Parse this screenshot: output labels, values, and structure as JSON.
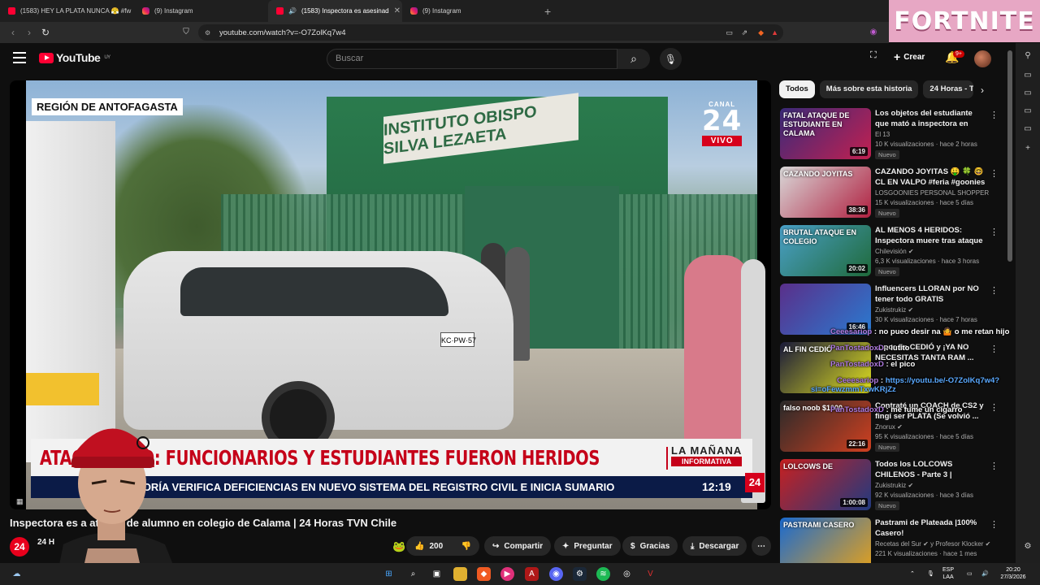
{
  "browser": {
    "tabs": [
      {
        "title": "(1583) HEY LA PLATA NUNCA 😤 #fw",
        "favicon": "youtube-favicon",
        "active": false
      },
      {
        "title": "(9) Instagram",
        "favicon": "instagram-favicon",
        "active": false
      },
      {
        "title": "(1583) Inspectora es asesinad",
        "favicon": "youtube-favicon",
        "active": true
      },
      {
        "title": "(9) Instagram",
        "favicon": "instagram-favicon",
        "active": false
      }
    ],
    "url": "youtube.com/watch?v=-O7ZolKq7w4",
    "new_tab": "+"
  },
  "overlay_banner": "FORTNITE",
  "youtube": {
    "logo_text": "YouTube",
    "region": "UY",
    "search_placeholder": "Buscar",
    "create_label": "Crear",
    "notif_badge": "9+"
  },
  "video": {
    "region_label": "REGIÓN DE ANTOFAGASTA",
    "channel_bug": {
      "canal": "CANAL",
      "number": "24",
      "live": "VIVO"
    },
    "sign_text": "INSTITUTO OBISPO SILVA LEZAETA",
    "plate": "KC·PW·57",
    "headline": "ATAQUE EN COLEGIO: FUNCIONARIOS Y ESTUDIANTES FUERON HERIDOS",
    "headline_visible": "ATAQU          LEGIO: FUNCIONARIOS Y ESTUDIANTES FUERON HERIDOS",
    "program": {
      "line1": "LA MAÑANA",
      "line2": "INFORMATIVA"
    },
    "ticker": "NAC          NTRALORÍA VERIFICA DEFICIENCIAS EN NUEVO SISTEMA DEL REGISTRO CIVIL E INICIA SUMARIO",
    "time": "12:19",
    "bug": "24",
    "title": "Inspectora es a          ataque de alumno en colegio de Calama | 24 Horas TVN Chile",
    "channel_avatar": "24",
    "channel_name": "24 H",
    "likes": "200",
    "actions": [
      "Compartir",
      "Preguntar",
      "Gracias",
      "Descargar"
    ]
  },
  "chips": [
    "Todos",
    "Más sobre esta historia",
    "24 Horas - TV"
  ],
  "recommendations": [
    {
      "title": "Los objetos del estudiante que mató a inspectora en Calama: ...",
      "channel": "El 13",
      "meta": "10 K visualizaciones · hace 2 horas",
      "badge": "Nuevo",
      "duration": "6:19",
      "thumb_text": "FATAL ATAQUE DE ESTUDIANTE EN CALAMA",
      "colors": [
        "#3a2a7a",
        "#c22050"
      ]
    },
    {
      "title": "CAZANDO JOYITAS 🤑 🍀 🤓 CL EN VALPO #feria #goonies ...",
      "channel": "LOSGOONIES PERSONAL SHOPPER",
      "meta": "15 K visualizaciones · hace 5 días",
      "badge": "Nuevo",
      "duration": "38:36",
      "thumb_text": "CAZANDO JOYITAS",
      "colors": [
        "#d9d9d9",
        "#b02040"
      ]
    },
    {
      "title": "AL MENOS 4 HERIDOS: Inspectora muere tras ataque ...",
      "channel": "Chilevisión ✔",
      "meta": "6,3 K visualizaciones · hace 3 horas",
      "badge": "Nuevo",
      "duration": "20:02",
      "thumb_text": "BRUTAL ATAQUE EN COLEGIO",
      "colors": [
        "#4aa0c8",
        "#1f6a3a"
      ]
    },
    {
      "title": "Influencers LLORAN por NO tener todo GRATIS",
      "channel": "Zukistrukiz ✔",
      "meta": "30 K visualizaciones · hace 7 horas",
      "badge": "",
      "duration": "16:46",
      "thumb_text": "",
      "colors": [
        "#5a2f8a",
        "#2a7ad0"
      ]
    },
    {
      "title": "... por fin CEDIÓ y ¡YA NO NECESITAS TANTA RAM ...",
      "channel": "",
      "meta": "",
      "badge": "",
      "duration": "",
      "thumb_text": "AL FIN CEDIÓ",
      "colors": [
        "#1a1a3a",
        "#e0e020"
      ]
    },
    {
      "title": "Contraté un COACH de CS2 y fingí ser PLATA (Se volvió ...",
      "channel": "Znorux ✔",
      "meta": "95 K visualizaciones · hace 5 días",
      "badge": "Nuevo",
      "duration": "22:16",
      "thumb_text": "falso noob $1000",
      "colors": [
        "#2a2a2a",
        "#d04020"
      ]
    },
    {
      "title": "Todos los LOLCOWS CHILENOS - Parte 3 | Documental",
      "channel": "Zukistrukiz ✔",
      "meta": "92 K visualizaciones · hace 3 días",
      "badge": "Nuevo",
      "duration": "1:00:08",
      "thumb_text": "LOLCOWS DE",
      "colors": [
        "#c82020",
        "#203a80"
      ]
    },
    {
      "title": "Pastrami de Plateada |100% Casero!",
      "channel": "Recetas del Sur ✔ y Profesor Klocker ✔",
      "meta": "221 K visualizaciones · hace 1 mes",
      "badge": "",
      "duration": "",
      "thumb_text": "PASTRAMI CASERO",
      "colors": [
        "#1a6ad0",
        "#e0a020"
      ]
    }
  ],
  "chat": [
    {
      "user": "Ceeesariop",
      "sep": ":",
      "text": "no pueo desir na 🤷 o me retan hijo"
    },
    {
      "user": "PanTostadoxD",
      "sep": ":",
      "text": "lutito"
    },
    {
      "user": "PanTostadoxD",
      "sep": ":",
      "text": "el pico"
    },
    {
      "user": "Ceeesariop",
      "sep": ":",
      "text": "https://youtu.be/-O7ZolKq7w4?si=oFewzmmTxwKRjZz"
    },
    {
      "user": "PanTostadoxD",
      "sep": ":",
      "text": "me fume un cigarro"
    }
  ],
  "taskbar": {
    "lang": "ESP",
    "layout": "LAA",
    "time": "20:20",
    "date": "27/3/2026"
  }
}
